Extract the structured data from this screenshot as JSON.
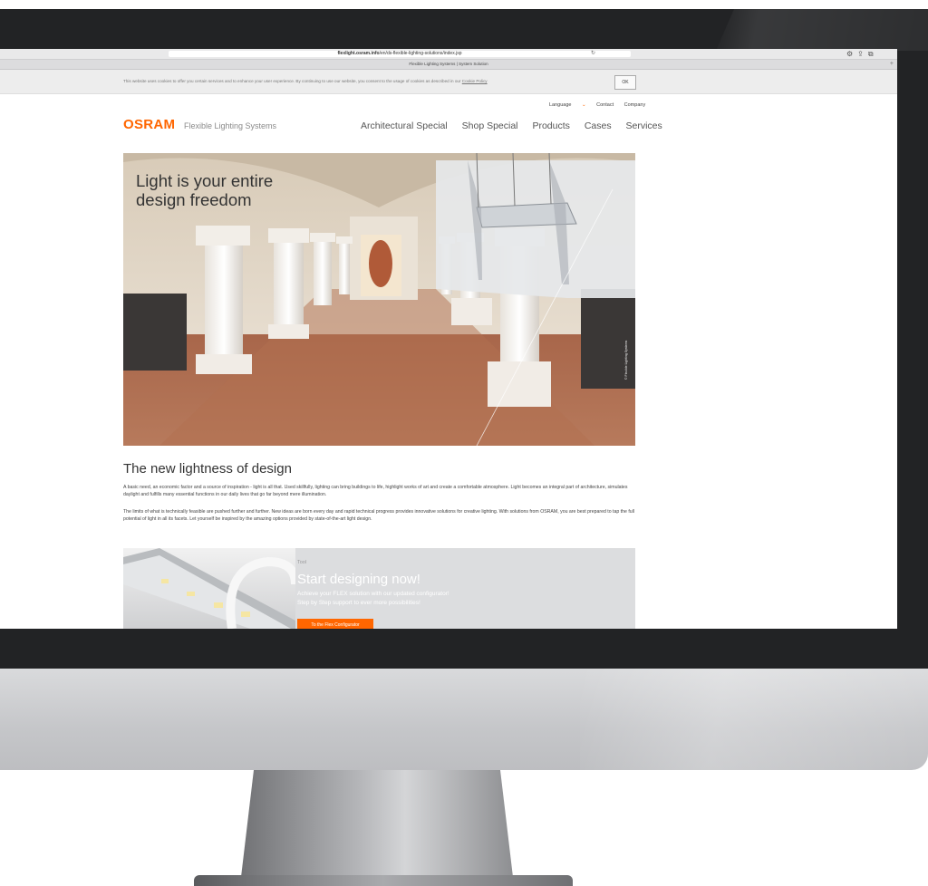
{
  "browser": {
    "url_host": "flexlight.osram.info",
    "url_path": "/en/ds-flexible-lighting-solutions/index.jsp",
    "tab_title": "Flexible Lighting Systems | System Solution"
  },
  "cookie": {
    "text": "This website uses cookies to offer you certain services and to enhance your user experience. By continuing to use our website, you consent to the usage of cookies as described in our",
    "policy_link": "Cookie Policy",
    "ok_label": "OK"
  },
  "header": {
    "logo": "OSRAM",
    "tagline": "Flexible Lighting Systems",
    "top_links": {
      "language": "Language",
      "contact": "Contact",
      "company": "Company"
    },
    "nav": [
      "Architectural Special",
      "Shop Special",
      "Products",
      "Cases",
      "Services"
    ]
  },
  "hero": {
    "title_line1": "Light is your entire",
    "title_line2": "design freedom",
    "credit": "© Flexible Lighting Systems"
  },
  "intro": {
    "title": "The new lightness of design",
    "paragraph1": "A basic need, an economic factor and a source of inspiration - light is all that. Used skillfully, lighting can bring buildings to life, highlight works of art and create a comfortable atmosphere. Light becomes an integral part of architecture, simulates daylight and fulfills many essential functions in our daily lives that go far beyond mere illumination.",
    "paragraph2": "The limits of what is technically feasible are pushed further and further. New ideas are born every day and rapid technical progress provides innovative solutions for creative lighting. With solutions from OSRAM, you are best prepared to tap the full potential of light in all its facets. Let yourself be inspired by the amazing options provided by state-of-the-art light design."
  },
  "promo": {
    "tag": "Tool",
    "title": "Start designing now!",
    "line1": "Achieve your FLEX solution with our updated configurator!",
    "line2": "Step by Step support to ever more possibilities!",
    "button": "To the Flex Configurator"
  },
  "colors": {
    "brand": "#ff6600",
    "bezel": "#222325"
  },
  "icons": {
    "reload": "reload-icon",
    "browser_actions": [
      "settings-icon",
      "share-icon",
      "tabs-icon"
    ]
  }
}
